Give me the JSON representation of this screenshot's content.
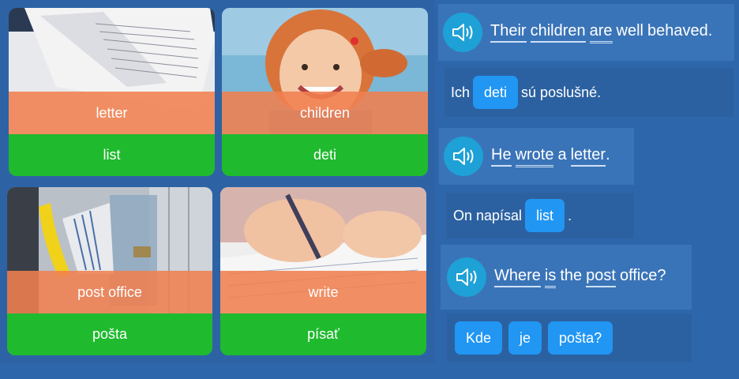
{
  "cards": [
    {
      "word": "letter",
      "translation": "list",
      "image": "handwritten-letter-image"
    },
    {
      "word": "children",
      "translation": "deti",
      "image": "smiling-girl-image"
    },
    {
      "word": "post office",
      "translation": "pošta",
      "image": "mailbox-image"
    },
    {
      "word": "write",
      "translation": "písať",
      "image": "writing-hand-image"
    }
  ],
  "sentences": [
    {
      "english_words": [
        "Their",
        "children",
        "are",
        "well",
        "behaved."
      ],
      "translation": {
        "before": "Ich",
        "chip": "deti",
        "after": "sú poslušné."
      }
    },
    {
      "english_words": [
        "He",
        "wrote",
        "a",
        "letter",
        "."
      ],
      "translation": {
        "before": "On napísal",
        "chip": "list",
        "after": "."
      }
    },
    {
      "english_words": [
        "Where",
        "is",
        "the",
        "post",
        "office?"
      ],
      "translation": {
        "chips": [
          "Kde",
          "je",
          "pošta?"
        ]
      }
    }
  ],
  "icons": {
    "speaker": "speaker-icon"
  },
  "colors": {
    "background": "#2e66ab",
    "word_band": "#f08050",
    "translation_band": "#1fba2e",
    "chip": "#2196f3",
    "speaker": "#1ea1d6"
  }
}
